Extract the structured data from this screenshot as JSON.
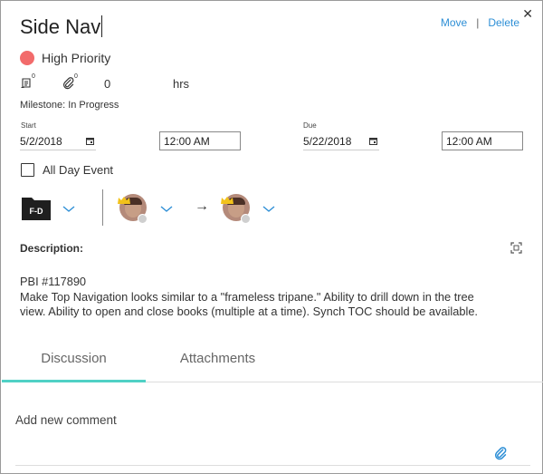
{
  "header": {
    "title": "Side Nav",
    "move_label": "Move",
    "separator": "|",
    "delete_label": "Delete",
    "close_glyph": "✕"
  },
  "priority": {
    "label": "High Priority",
    "color": "#f26b6b"
  },
  "meta": {
    "tasks_count": "0",
    "attachments_count": "0",
    "hours_value": "0",
    "hours_unit": "hrs"
  },
  "milestone": {
    "text": "Milestone: In Progress"
  },
  "dates": {
    "start_label": "Start",
    "start_date": "5/2/2018",
    "start_time": "12:00 AM",
    "due_label": "Due",
    "due_date": "5/22/2018",
    "due_time": "12:00 AM"
  },
  "all_day": {
    "label": "All Day Event",
    "checked": false
  },
  "assignment": {
    "folder_label": "F-D",
    "arrow": "→"
  },
  "description": {
    "label": "Description:",
    "line1": "PBI #117890",
    "line2": "Make Top Navigation looks similar to a \"frameless tripane.\" Ability to drill down in the tree",
    "line3": "view. Ability to open and close books (multiple at a time). Synch TOC should be available."
  },
  "tabs": [
    {
      "label": "Discussion",
      "active": true
    },
    {
      "label": "Attachments",
      "active": false
    }
  ],
  "comment": {
    "placeholder": "Add new comment"
  },
  "colors": {
    "accent": "#2e8fd6",
    "tab_indicator": "#4fd1c5",
    "priority": "#f26b6b"
  }
}
